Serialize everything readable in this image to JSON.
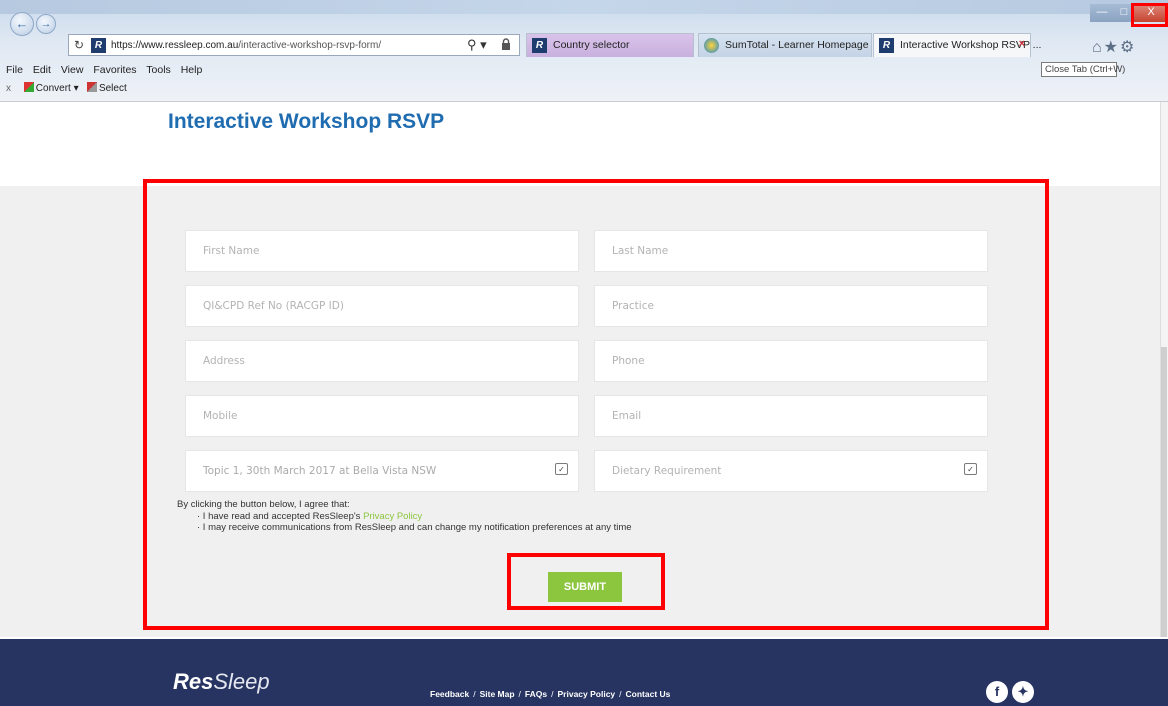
{
  "browser": {
    "address_url_domain": "https://www.ressleep.com.au",
    "address_url_path": "/interactive-workshop-rsvp-form/",
    "favicon_letter": "R",
    "tabs": [
      {
        "label": "Country selector",
        "favicon": "R"
      },
      {
        "label": "SumTotal - Learner Homepage",
        "favicon": "ie-icon"
      },
      {
        "label": "Interactive Workshop RSVP ...",
        "favicon": "R",
        "close": "×"
      }
    ],
    "tooltip": "Close Tab (Ctrl+W)",
    "menu": [
      "File",
      "Edit",
      "View",
      "Favorites",
      "Tools",
      "Help"
    ],
    "command_bar": {
      "close": "x",
      "convert": "Convert",
      "select": "Select"
    },
    "window_close": "X"
  },
  "page": {
    "title": "Interactive Workshop RSVP",
    "form": {
      "first_name": "First Name",
      "last_name": "Last Name",
      "qi_cpd": "QI&CPD Ref No (RACGP ID)",
      "practice": "Practice",
      "address": "Address",
      "phone": "Phone",
      "mobile": "Mobile",
      "email": "Email",
      "topic_selected": "Topic 1, 30th March 2017 at Bella Vista NSW",
      "dietary": "Dietary Requirement"
    },
    "agreement": {
      "intro": "By clicking the button below, I agree that:",
      "item1_prefix": "· I have read and accepted ResSleep's ",
      "item1_link": "Privacy Policy",
      "item2": "· I may receive communications from ResSleep and can change my notification preferences at any time"
    },
    "submit_label": "SUBMIT"
  },
  "footer": {
    "logo_bold": "Res",
    "logo_light": "Sleep",
    "links": [
      "Feedback",
      "Site Map",
      "FAQs",
      "Privacy Policy",
      "Contact Us"
    ],
    "separator": "/",
    "social": {
      "facebook": "f",
      "twitter": "t"
    }
  },
  "colors": {
    "title_blue": "#1f6cb0",
    "accent_green": "#8cc63f",
    "footer_navy": "#273462",
    "highlight_red": "#ff0000"
  }
}
